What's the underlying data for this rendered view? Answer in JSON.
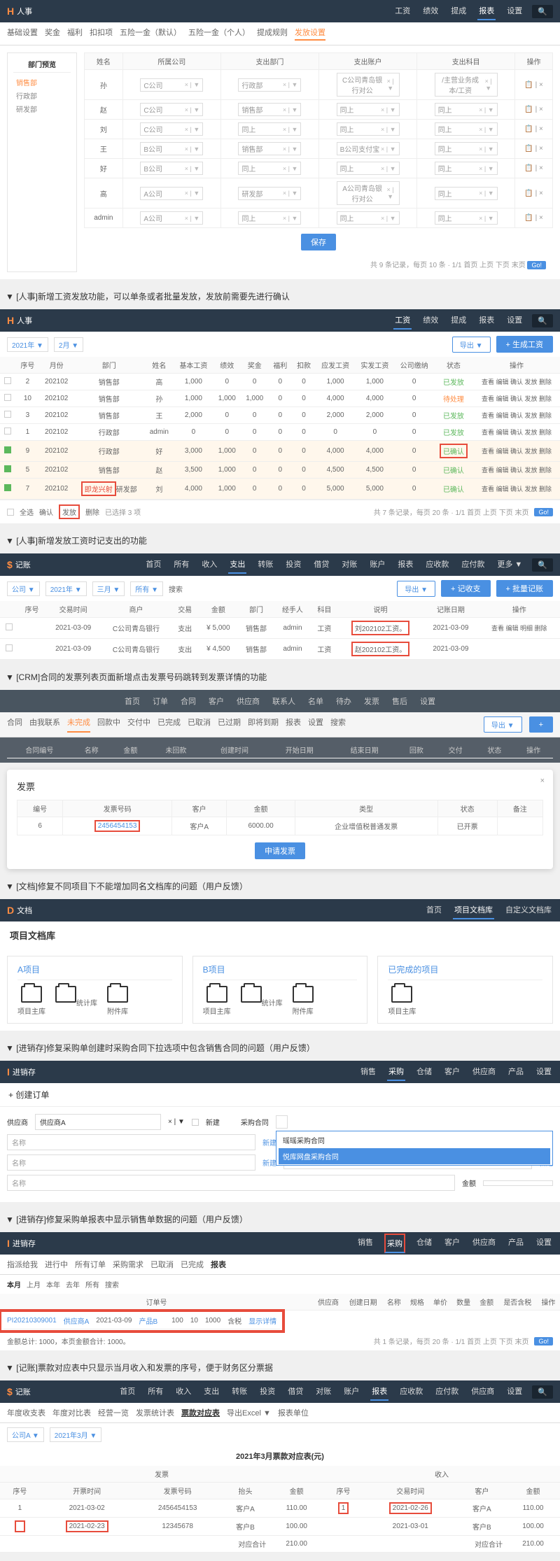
{
  "hr1": {
    "brand": "人事",
    "nav": [
      "工资",
      "绩效",
      "提成",
      "报表",
      "设置"
    ],
    "subnav": [
      "基础设置",
      "奖金",
      "福利",
      "扣扣项",
      "五险一金（默认）",
      "五险一金（个人）",
      "提成规则",
      "发放设置"
    ],
    "sidebar": {
      "title": "部门预览",
      "items": [
        "销售部",
        "行政部",
        "研发部"
      ]
    },
    "cols": [
      "姓名",
      "所属公司",
      "支出部门",
      "支出账户",
      "支出科目",
      "操作"
    ],
    "rows": [
      {
        "name": "孙",
        "co": "C公司",
        "dept": "行政部",
        "acct": "C公司青岛银行对公",
        "subj": "/主营业务成本/工资"
      },
      {
        "name": "赵",
        "co": "C公司",
        "dept": "销售部",
        "acct": "同上",
        "subj": "同上"
      },
      {
        "name": "刘",
        "co": "C公司",
        "dept": "同上",
        "acct": "同上",
        "subj": "同上"
      },
      {
        "name": "王",
        "co": "B公司",
        "dept": "销售部",
        "acct": "B公司支付宝",
        "subj": "同上"
      },
      {
        "name": "好",
        "co": "B公司",
        "dept": "同上",
        "acct": "同上",
        "subj": "同上"
      },
      {
        "name": "高",
        "co": "A公司",
        "dept": "研发部",
        "acct": "A公司青岛银行对公",
        "subj": "同上"
      },
      {
        "name": "admin",
        "co": "A公司",
        "dept": "同上",
        "acct": "同上",
        "subj": "同上"
      }
    ],
    "save": "保存",
    "footer": "共 9 条记录，每页 10 条 · 1/1   首页 上页 下页 末页",
    "go": "Go!"
  },
  "cap1": "▼ [人事]新增工资发放功能，可以单条或者批量发放，发放前需要先进行确认",
  "hr2": {
    "brand": "人事",
    "nav": [
      "工资",
      "绩效",
      "提成",
      "报表",
      "设置"
    ],
    "filter": {
      "year": "2021年 ▼",
      "month": "2月 ▼"
    },
    "export": "导出 ▼",
    "gen": "+ 生成工资",
    "cols": [
      "",
      "序号",
      "月份",
      "部门",
      "姓名",
      "基本工资",
      "绩效",
      "奖金",
      "福利",
      "扣款",
      "应发工资",
      "实发工资",
      "公司缴纳",
      "状态",
      "操作"
    ],
    "rows": [
      {
        "c": 0,
        "n": "2",
        "m": "202102",
        "d": "销售部",
        "nm": "高",
        "b": "1,000",
        "p": "0",
        "bo": "0",
        "w": "0",
        "k": "0",
        "y": "1,000",
        "s": "1,000",
        "g": "0",
        "st": "已发放",
        "stc": "g",
        "op": "查看 编辑 确认 发放 删除"
      },
      {
        "c": 0,
        "n": "10",
        "m": "202102",
        "d": "销售部",
        "nm": "孙",
        "b": "1,000",
        "p": "1,000",
        "bo": "1,000",
        "w": "0",
        "k": "0",
        "y": "4,000",
        "s": "4,000",
        "g": "0",
        "st": "待处理",
        "stc": "o",
        "op": "查看 编辑 确认 发放 删除"
      },
      {
        "c": 0,
        "n": "3",
        "m": "202102",
        "d": "销售部",
        "nm": "王",
        "b": "2,000",
        "p": "0",
        "bo": "0",
        "w": "0",
        "k": "0",
        "y": "2,000",
        "s": "2,000",
        "g": "0",
        "st": "已发放",
        "stc": "g",
        "op": "查看 编辑 确认 发放 删除"
      },
      {
        "c": 0,
        "n": "1",
        "m": "202102",
        "d": "行政部",
        "nm": "admin",
        "b": "0",
        "p": "0",
        "bo": "0",
        "w": "0",
        "k": "0",
        "y": "0",
        "s": "0",
        "g": "0",
        "st": "已发放",
        "stc": "g",
        "op": "查看 编辑 确认 发放 删除"
      },
      {
        "c": 1,
        "n": "9",
        "m": "202102",
        "d": "行政部",
        "nm": "好",
        "b": "3,000",
        "p": "1,000",
        "bo": "0",
        "w": "0",
        "k": "0",
        "y": "4,000",
        "s": "4,000",
        "g": "0",
        "st": "已确认",
        "stc": "g",
        "op": "查看 编辑 确认 发放 删除",
        "hl": 1,
        "rb": 1
      },
      {
        "c": 1,
        "n": "5",
        "m": "202102",
        "d": "销售部",
        "nm": "赵",
        "b": "3,500",
        "p": "1,000",
        "bo": "0",
        "w": "0",
        "k": "0",
        "y": "4,500",
        "s": "4,500",
        "g": "0",
        "st": "已确认",
        "stc": "g",
        "op": "查看 编辑 确认 发放 删除",
        "hl": 1
      },
      {
        "c": 1,
        "n": "7",
        "m": "202102",
        "d": "研发部",
        "nm": "刘",
        "b": "4,000",
        "p": "1,000",
        "bo": "0",
        "w": "0",
        "k": "0",
        "y": "5,000",
        "s": "5,000",
        "g": "0",
        "st": "已确认",
        "stc": "g",
        "op": "查看 编辑 确认 发放 删除",
        "hl": 1,
        "dept_red": "即龙兴射"
      }
    ],
    "batch": [
      "全选",
      "确认",
      "发放",
      "删除"
    ],
    "selected": "已选择 3 项",
    "footer": "共 7 条记录，每页 20 条 · 1/1   首页 上页 下页 末页"
  },
  "cap2": "▼ [人事]新增发放工资时记支出的功能",
  "acc": {
    "brand": "记账",
    "nav": [
      "首页",
      "所有",
      "收入",
      "支出",
      "转账",
      "投资",
      "借贷",
      "对账",
      "账户",
      "报表",
      "应收款",
      "应付款",
      "更多 ▼"
    ],
    "filter": {
      "co": "公司 ▼",
      "year": "2021年 ▼",
      "month": "三月 ▼",
      "all": "所有 ▼",
      "search": "搜索"
    },
    "btns": [
      "导出 ▼",
      "+ 记收支",
      "+ 批量记账"
    ],
    "cols": [
      "",
      "序号",
      "交易时间",
      "商户",
      "交易",
      "金额",
      "部门",
      "经手人",
      "科目",
      "说明",
      "记账日期",
      "操作"
    ],
    "rows": [
      {
        "n": "",
        "t": "2021-03-09",
        "m": "C公司青岛银行",
        "tp": "支出",
        "a": "¥ 5,000",
        "d": "销售部",
        "p": "admin",
        "s": "工资",
        "desc": "刘202102工资。",
        "dt": "2021-03-09",
        "op": "查看 编辑 明细 删除"
      },
      {
        "n": "",
        "t": "2021-03-09",
        "m": "C公司青岛银行",
        "tp": "支出",
        "a": "¥ 4,500",
        "d": "销售部",
        "p": "admin",
        "s": "工资",
        "desc": "赵202102工资。",
        "dt": "2021-03-09",
        "op": ""
      }
    ]
  },
  "cap3": "▼ [CRM]合同的发票列表页面新增点击发票号码跳转到发票详情的功能",
  "crm": {
    "nav": [
      "首页",
      "订单",
      "合同",
      "客户",
      "供应商",
      "联系人",
      "名单",
      "待办",
      "发票",
      "售后",
      "设置"
    ],
    "sub": [
      "合同",
      "由我联系",
      "未完成",
      "回款中",
      "交付中",
      "已完成",
      "已取消",
      "已过期",
      "即将到期",
      "报表",
      "设置",
      "搜索"
    ],
    "export": "导出 ▼",
    "cols": [
      "合同编号",
      "名称",
      "金额",
      "未回款",
      "创建时间",
      "开始日期",
      "结束日期",
      "回款",
      "交付",
      "状态",
      "操作"
    ],
    "modal": {
      "title": "发票",
      "cols": [
        "编号",
        "发票号码",
        "客户",
        "金额",
        "类型",
        "状态",
        "备注"
      ],
      "row": {
        "id": "6",
        "no": "2456454153",
        "cust": "客户A",
        "amt": "6000.00",
        "type": "企业增值税普通发票",
        "st": "已开票",
        "note": ""
      },
      "btn": "申请发票"
    }
  },
  "cap4": "▼ [文档]修复不同项目下不能增加同名文档库的问题（用户反馈）",
  "doc": {
    "brand": "文档",
    "nav": [
      "首页",
      "项目文档库",
      "自定义文档库"
    ],
    "title": "项目文档库",
    "cards": [
      {
        "title": "A项目",
        "items": [
          "项目主库",
          "统计库",
          "附件库"
        ],
        "hl": 1
      },
      {
        "title": "B项目",
        "items": [
          "项目主库",
          "统计库",
          "附件库"
        ],
        "hl": 1
      },
      {
        "title": "已完成的项目",
        "items": [
          "项目主库"
        ]
      }
    ]
  },
  "cap5": "▼ [进销存]修复采购单创建时采购合同下拉选项中包含销售合同的问题（用户反馈）",
  "po": {
    "brand": "进销存",
    "nav": [
      "销售",
      "采购",
      "仓储",
      "客户",
      "供应商",
      "产品",
      "设置"
    ],
    "title": "+ 创建订单",
    "supplier_label": "供应商",
    "supplier": "供应商A",
    "new": "新建",
    "contract_label": "采购合同",
    "menu": [
      "瑶瑶采购合同",
      "悦库网盘采购合同"
    ],
    "name": "名称",
    "amt": "金额"
  },
  "cap6": "▼ [进销存]修复采购单报表中显示销售单数据的问题（用户反馈）",
  "po2": {
    "brand": "进销存",
    "nav": [
      "销售",
      "采购",
      "仓储",
      "客户",
      "供应商",
      "产品",
      "设置"
    ],
    "sub": [
      "指派给我",
      "进行中",
      "所有订单",
      "采购需求",
      "已取消",
      "已完成",
      "报表"
    ],
    "tabs": [
      "本月",
      "上月",
      "本年",
      "去年",
      "所有",
      "搜索"
    ],
    "cols": [
      "订单号",
      "供应商",
      "创建日期",
      "名称",
      "规格",
      "单价",
      "数量",
      "金额",
      "是否含税",
      "操作"
    ],
    "row": {
      "no": "PI20210309001",
      "sup": "供应商A",
      "dt": "2021-03-09",
      "nm": "产品B",
      "spec": "",
      "price": "100",
      "qty": "10",
      "amt": "1000",
      "tax": "含税",
      "op": "显示详情"
    },
    "footer": "金额总计: 1000，本页金额合计: 1000。",
    "pager": "共 1 条记录，每页 20 条 · 1/1   首页 上页 下页 末页"
  },
  "cap7": "▼ [记账]票款对应表中只显示当月收入和发票的序号，便于财务区分票据",
  "acc2": {
    "brand": "记账",
    "nav": [
      "首页",
      "所有",
      "收入",
      "支出",
      "转账",
      "投资",
      "借贷",
      "对账",
      "账户",
      "报表",
      "应收款",
      "应付款",
      "供应商",
      "设置"
    ],
    "sub": [
      "年度收支表",
      "年度对比表",
      "经营一览",
      "发票统计表",
      "票款对应表",
      "导出Excel ▼",
      "报表单位"
    ],
    "filter": {
      "co": "公司A ▼",
      "date": "2021年3月 ▼"
    },
    "title": "2021年3月票款对应表(元)",
    "grp": [
      "发票",
      "收入"
    ],
    "cols": [
      "序号",
      "开票时间",
      "发票号码",
      "抬头",
      "金额",
      "序号",
      "交易时间",
      "客户",
      "金额"
    ],
    "rows": [
      {
        "n": "1",
        "t": "2021-03-02",
        "no": "2456454153",
        "h": "客户A",
        "a": "110.00",
        "n2": "1",
        "t2": "2021-02-26",
        "c": "客户A",
        "a2": "110.00"
      },
      {
        "n": "",
        "t": "2021-02-23",
        "no": "12345678",
        "h": "客户B",
        "a": "100.00",
        "n2": "",
        "t2": "2021-03-01",
        "c": "客户B",
        "a2": "100.00"
      }
    ],
    "totals": {
      "l": "对应合计",
      "la": "210.00",
      "r": "对应合计",
      "ra": "210.00"
    }
  }
}
